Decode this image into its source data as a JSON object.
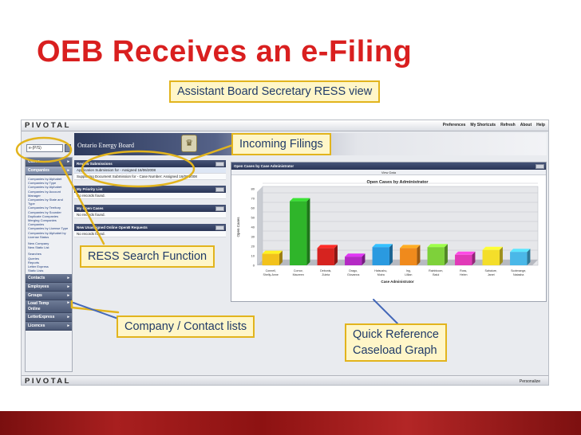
{
  "slide": {
    "title": "OEB Receives an e-Filing",
    "accent_color": "#d91f1f",
    "callout_border_color": "#e2b41d",
    "callouts": {
      "ress_view": "Assistant Board Secretary RESS view",
      "incoming": "Incoming Filings",
      "search": "RESS Search Function",
      "company": "Company / Contact lists",
      "quick_ref_1": "Quick Reference",
      "quick_ref_2": "Caseload Graph"
    }
  },
  "app": {
    "logo": "PIVOTAL",
    "banner_title": "Ontario Energy Board",
    "top_links": [
      "Preferences",
      "My Shortcuts",
      "Refresh",
      "About",
      "Help"
    ],
    "search_value": "e-(P/S)",
    "personalize": "Personalize",
    "nav": {
      "cases": "Cases",
      "companies": "Companies",
      "companies_sub": [
        "Companies by Alphabet",
        "Companies by Type",
        "Companies by Alphabet",
        "Companies by Account Manager",
        "Companies by State and Type",
        "Companies by Territory",
        "Companies by Sounder",
        "Duplicate Companies",
        "Merging Companies",
        "Companies",
        "Companies by License Type",
        "Companies by Alphabet by License Status"
      ],
      "actions": [
        "New Company",
        "New Static List"
      ],
      "tools": [
        "Searches",
        "Queries",
        "Reports",
        "Letter Express",
        "Static Lists"
      ],
      "contacts": "Contacts",
      "employees": "Employees",
      "groups": "Groups",
      "load_temp_1": "Load Temp",
      "load_temp_2": "Online",
      "letter_express": "LetterExpress",
      "licences": "Licences"
    },
    "panels": {
      "review_title": "Review Submissions",
      "review_rows": [
        "Application Submission for - Assigned 16/06/2008",
        "Supporting Document Submission for - Case Number: Assigned 16/06/2008"
      ],
      "priority_title": "My Priority List",
      "priority_empty": "No records found.",
      "open_title": "My Open Cases",
      "open_empty": "No records found.",
      "unassigned_title": "New Unassigned Online OpenB Requests",
      "unassigned_empty": "No records found."
    },
    "chart_panel": {
      "header": "Open Cases by Case Administrator",
      "view_data": "View Data"
    }
  },
  "chart_data": {
    "type": "bar",
    "title": "Open Cases by Administrator",
    "xlabel": "Case Administrator",
    "ylabel": "Open Cases",
    "ylim": [
      0,
      80
    ],
    "yticks": [
      0,
      10,
      20,
      30,
      40,
      50,
      60,
      70,
      80
    ],
    "grid": true,
    "categories": [
      "Connell, Shelly-Anne",
      "Cornor, Maureen",
      "Debonis, Zuleia",
      "Drago, Giovanna",
      "Hatsushu, Moira",
      "Ing, Lillian",
      "Rainbloom, Balul",
      "Ross, Helen",
      "Sahaiure, Janet",
      "Scotmange, Natasha"
    ],
    "values": [
      12,
      67,
      18,
      9,
      19,
      18,
      19,
      11,
      16,
      14
    ],
    "colors": [
      "#f2c21b",
      "#2fb52a",
      "#d6231f",
      "#b42ac4",
      "#2a9ae0",
      "#f08a1c",
      "#7ed13a",
      "#e13ab8",
      "#f4de2a",
      "#4ab8e8"
    ]
  }
}
